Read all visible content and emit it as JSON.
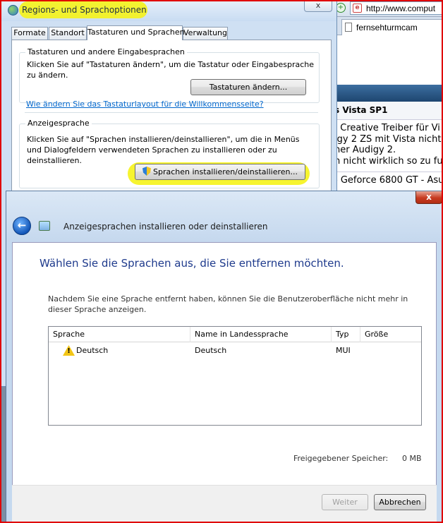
{
  "browser": {
    "address": "http://www.comput",
    "tab_title": "fernsehturmcam",
    "article_heading": "s Vista SP1",
    "article_lines": [
      ". Creative Treiber für Vi",
      "igy 2 ZS mit Vista nicht n",
      "ner Audigy 2.",
      "h nicht wirklich so zu fur"
    ],
    "article_line2": "- Geforce 6800 GT - Asu"
  },
  "regional_dialog": {
    "title": "Regions- und Sprachoptionen",
    "close_glyph": "x",
    "tabs": [
      {
        "label": "Formate"
      },
      {
        "label": "Standort"
      },
      {
        "label": "Tastaturen und Sprachen",
        "active": true
      },
      {
        "label": "Verwaltung"
      }
    ],
    "keyboards_group": {
      "legend": "Tastaturen und andere Eingabesprachen",
      "text": "Klicken Sie auf \"Tastaturen ändern\", um die Tastatur oder Eingabesprache zu ändern.",
      "button": "Tastaturen ändern..."
    },
    "welcome_link": "Wie ändern Sie das Tastaturlayout für die Willkommensseite?",
    "display_group": {
      "legend": "Anzeigesprache",
      "text": "Klicken Sie auf \"Sprachen installieren/deinstallieren\", um die in Menüs und Dialogfeldern verwendeten Sprachen zu installieren oder zu deinstallieren.",
      "button": "Sprachen installieren/deinstallieren..."
    }
  },
  "language_wizard": {
    "close_glyph": "x",
    "back_glyph": "←",
    "caption": "Anzeigesprachen installieren oder deinstallieren",
    "heading": "Wählen Sie die Sprachen aus, die Sie entfernen möchten.",
    "info": "Nachdem Sie eine Sprache entfernt haben, können Sie die Benutzeroberfläche nicht mehr in dieser Sprache anzeigen.",
    "columns": [
      "Sprache",
      "Name in Landessprache",
      "Typ",
      "Größe"
    ],
    "rows": [
      {
        "sprache": "Deutsch",
        "landessprache": "Deutsch",
        "typ": "MUI",
        "groesse": "",
        "warning_glyph": "!"
      }
    ],
    "freed_label": "Freigegebener Speicher:",
    "freed_value": "0 MB",
    "next_button": "Weiter",
    "cancel_button": "Abbrechen"
  },
  "colors": {
    "highlight": "#f5f31a",
    "link": "#0066cc",
    "heading": "#1e3a8c",
    "close_red": "#c73b21"
  }
}
